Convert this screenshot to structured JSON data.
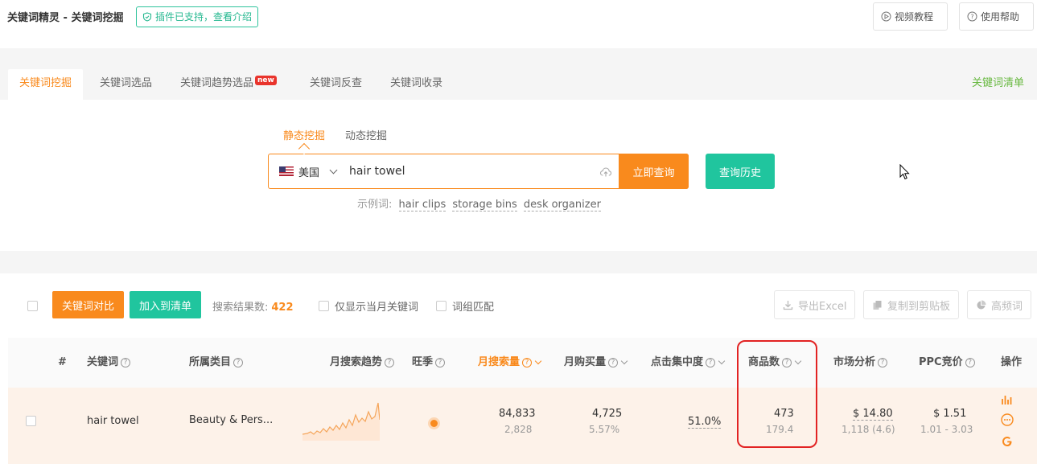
{
  "header": {
    "title": "关键词精灵 - 关键词挖掘",
    "plugin_badge": "插件已支持，查看介绍",
    "video_tutorial": "视频教程",
    "help": "使用帮助"
  },
  "tabs": [
    {
      "label": "关键词挖掘",
      "active": true
    },
    {
      "label": "关键词选品"
    },
    {
      "label": "关键词趋势选品",
      "badge": "new"
    },
    {
      "label": "关键词反查"
    },
    {
      "label": "关键词收录"
    }
  ],
  "tab_right": "关键词清单",
  "search": {
    "modes": [
      "静态挖掘",
      "动态挖掘"
    ],
    "country": "美国",
    "query": "hair towel",
    "submit": "立即查询",
    "history": "查询历史",
    "examples_label": "示例词:",
    "examples": [
      "hair clips",
      "storage bins",
      "desk organizer"
    ]
  },
  "toolbar": {
    "compare": "关键词对比",
    "add_list": "加入到清单",
    "result_label": "搜索结果数:",
    "result_count": "422",
    "only_month": "仅显示当月关键词",
    "group_match": "词组匹配",
    "export": "导出Excel",
    "copy": "复制到剪贴板",
    "freq": "高频词"
  },
  "table": {
    "headers": {
      "index": "#",
      "keyword": "关键词",
      "category": "所属类目",
      "trend": "月搜索趋势",
      "peak": "旺季",
      "monthly_search": "月搜索量",
      "monthly_purchase": "月购买量",
      "click_concentration": "点击集中度",
      "products": "商品数",
      "market": "市场分析",
      "ppc": "PPC竞价",
      "actions": "操作"
    },
    "rows": [
      {
        "keyword": "hair towel",
        "category": "Beauty & Pers...",
        "monthly_search": "84,833",
        "monthly_search_sub": "2,828",
        "monthly_purchase": "4,725",
        "monthly_purchase_sub": "5.57%",
        "click_concentration": "51.0%",
        "products": "473",
        "products_sub": "179.4",
        "market_price": "$ 14.80",
        "market_sub": "1,118 (4.6)",
        "ppc": "$ 1.51",
        "ppc_range": "1.01 - 3.03"
      }
    ]
  },
  "colors": {
    "accent": "#f98a1d",
    "teal": "#20c59e",
    "green": "#67b83f",
    "highlight": "#e22323"
  }
}
